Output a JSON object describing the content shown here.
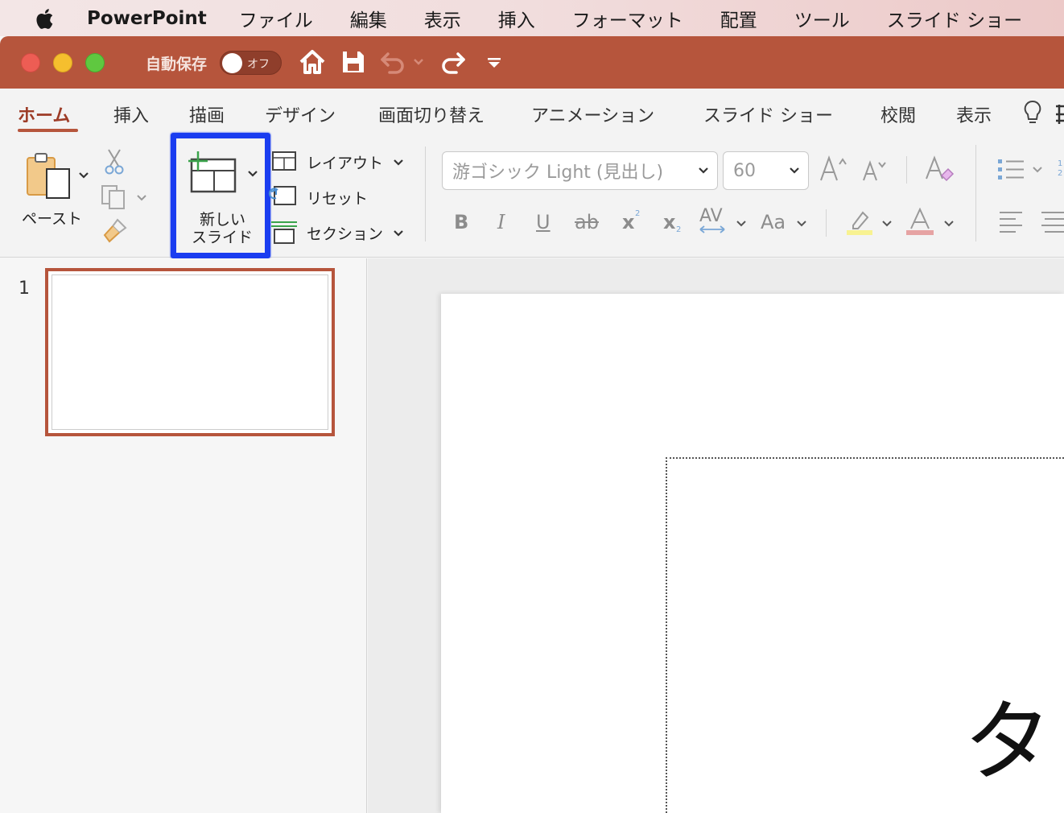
{
  "menubar": {
    "app_name": "PowerPoint",
    "items": [
      "ファイル",
      "編集",
      "表示",
      "挿入",
      "フォーマット",
      "配置",
      "ツール",
      "スライド ショー"
    ]
  },
  "titlebar": {
    "autosave_label": "自動保存",
    "autosave_state": "オフ"
  },
  "tabs": [
    "ホーム",
    "挿入",
    "描画",
    "デザイン",
    "画面切り替え",
    "アニメーション",
    "スライド ショー",
    "校閲",
    "表示"
  ],
  "ribbon": {
    "paste_label": "ペースト",
    "new_slide_label_line1": "新しい",
    "new_slide_label_line2": "スライド",
    "layout_label": "レイアウト",
    "reset_label": "リセット",
    "section_label": "セクション",
    "font_name": "游ゴシック Light (見出し)",
    "font_size": "60",
    "format_buttons": {
      "bold": "B",
      "italic": "I",
      "underline": "U",
      "strikethrough": "ab",
      "superscript": "x",
      "subscript": "x",
      "spacing": "AV",
      "case": "Aa"
    }
  },
  "thumbnails": {
    "slide_number": "1"
  },
  "slide": {
    "title_text_visible": "タ"
  },
  "colors": {
    "accent": "#b6553c",
    "highlight_box": "#1a3df0"
  }
}
